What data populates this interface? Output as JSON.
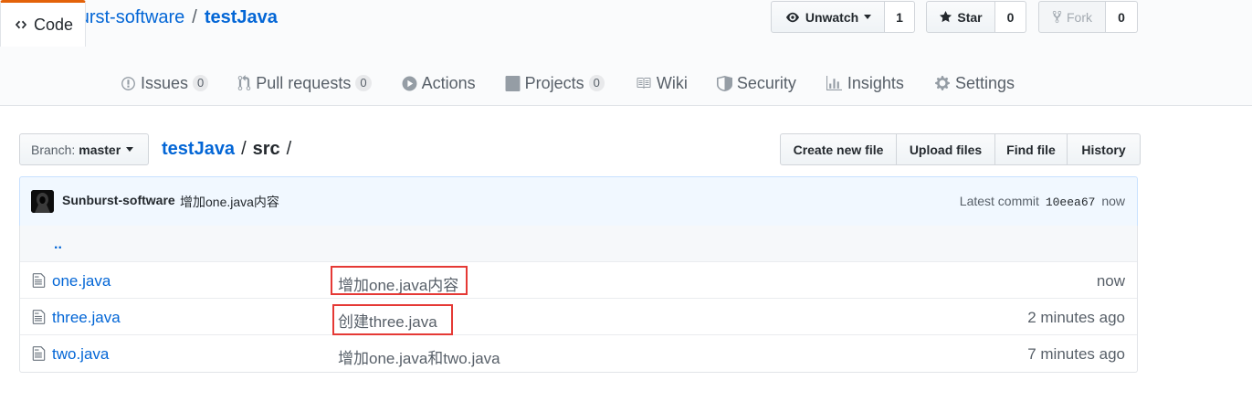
{
  "repo": {
    "owner": "Sunburst-software",
    "separator": "/",
    "name": "testJava"
  },
  "actions": {
    "watch": {
      "label": "Unwatch",
      "count": "1"
    },
    "star": {
      "label": "Star",
      "count": "0"
    },
    "fork": {
      "label": "Fork",
      "count": "0"
    }
  },
  "tabs": [
    {
      "label": "Code",
      "icon": "code-icon"
    },
    {
      "label": "Issues",
      "count": "0",
      "icon": "issue-icon"
    },
    {
      "label": "Pull requests",
      "count": "0",
      "icon": "pull-request-icon"
    },
    {
      "label": "Actions",
      "icon": "play-icon"
    },
    {
      "label": "Projects",
      "count": "0",
      "icon": "project-icon"
    },
    {
      "label": "Wiki",
      "icon": "book-icon"
    },
    {
      "label": "Security",
      "icon": "shield-icon"
    },
    {
      "label": "Insights",
      "icon": "graph-icon"
    },
    {
      "label": "Settings",
      "icon": "gear-icon"
    }
  ],
  "branch": {
    "label": "Branch:",
    "value": "master"
  },
  "breadcrumb": {
    "root": "testJava",
    "sep": "/",
    "current": "src",
    "trail": "/"
  },
  "file_actions": {
    "create": "Create new file",
    "upload": "Upload files",
    "find": "Find file",
    "history": "History"
  },
  "latest_commit": {
    "author": "Sunburst-software",
    "message": "增加one.java内容",
    "prefix": "Latest commit",
    "sha": "10eea67",
    "age": "now"
  },
  "parent_dir": "..",
  "files": [
    {
      "name": "one.java",
      "message": "增加one.java内容",
      "age": "now",
      "highlighted": true
    },
    {
      "name": "three.java",
      "message": "创建three.java",
      "age": "2 minutes ago",
      "highlighted": true
    },
    {
      "name": "two.java",
      "message": "增加one.java和two.java",
      "age": "7 minutes ago",
      "highlighted": false
    }
  ],
  "colors": {
    "link": "#0366d6",
    "tab_accent": "#e36209",
    "highlight": "#e53935"
  }
}
